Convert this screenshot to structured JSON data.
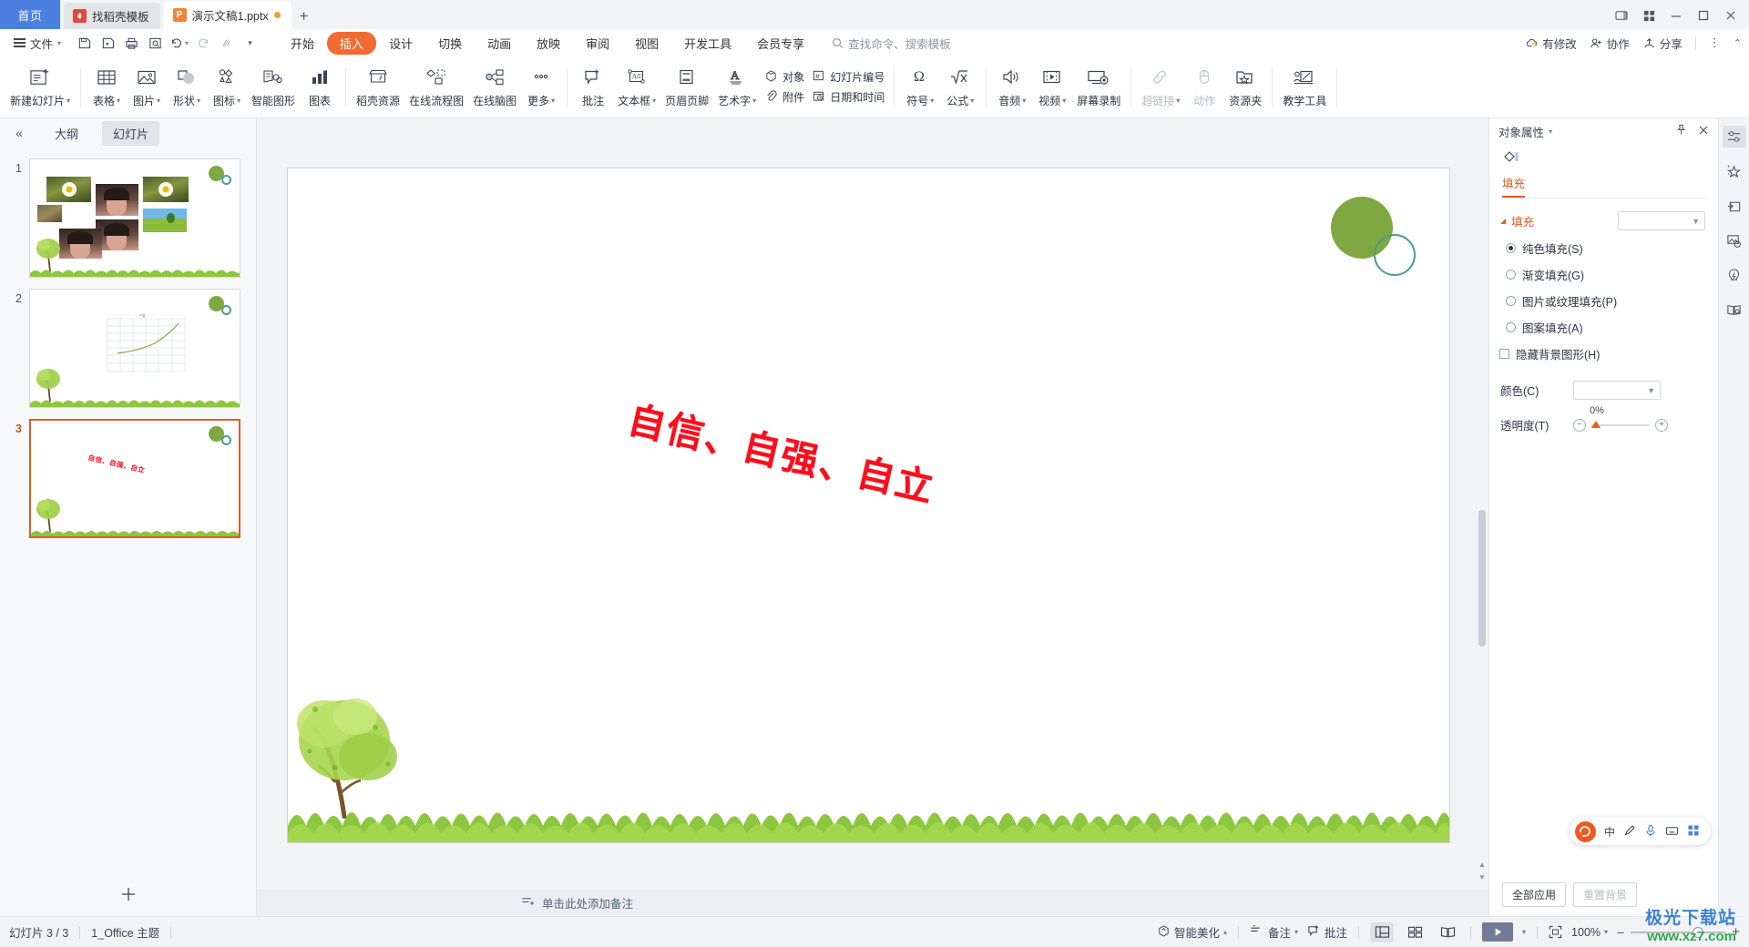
{
  "window": {
    "home_tab": "首页",
    "tabs": [
      {
        "label": "找稻壳模板",
        "icon": "daoke-icon",
        "active": false,
        "modified": false
      },
      {
        "label": "演示文稿1.pptx",
        "icon": "wpp-icon",
        "active": true,
        "modified": true
      }
    ],
    "new_tab": "+",
    "controls": [
      "restore-icon",
      "grid-icon",
      "minimize-icon",
      "maximize-icon",
      "close-icon"
    ]
  },
  "menu": {
    "file_label": "文件",
    "quick_access": [
      "save-icon",
      "save-as-icon",
      "print-icon",
      "print-preview-icon",
      "undo-icon",
      "redo-icon",
      "format-painter-icon",
      "customize-icon"
    ],
    "ribbon_tabs": [
      {
        "label": "开始",
        "selected": false
      },
      {
        "label": "插入",
        "selected": true
      },
      {
        "label": "设计",
        "selected": false
      },
      {
        "label": "切换",
        "selected": false
      },
      {
        "label": "动画",
        "selected": false
      },
      {
        "label": "放映",
        "selected": false
      },
      {
        "label": "审阅",
        "selected": false
      },
      {
        "label": "视图",
        "selected": false
      },
      {
        "label": "开发工具",
        "selected": false
      },
      {
        "label": "会员专享",
        "selected": false
      }
    ],
    "search_placeholder": "查找命令、搜索模板",
    "right_items": [
      {
        "label": "有修改",
        "icon": "cloud-sync-icon"
      },
      {
        "label": "协作",
        "icon": "collaborate-icon"
      },
      {
        "label": "分享",
        "icon": "share-icon"
      }
    ],
    "more_icon": "more-vertical-icon",
    "collapse_icon": "chevron-up-icon"
  },
  "ribbon": {
    "groups": [
      {
        "buttons": [
          {
            "label": "新建幻灯片",
            "icon": "new-slide-icon",
            "dropdown": true,
            "disabled": false
          }
        ]
      },
      {
        "buttons": [
          {
            "label": "表格",
            "icon": "table-icon",
            "dropdown": true,
            "disabled": false
          },
          {
            "label": "图片",
            "icon": "picture-icon",
            "dropdown": true,
            "disabled": false
          },
          {
            "label": "形状",
            "icon": "shapes-icon",
            "dropdown": true,
            "disabled": false
          },
          {
            "label": "图标",
            "icon": "icons-icon",
            "dropdown": true,
            "disabled": false
          },
          {
            "label": "智能图形",
            "icon": "smartart-icon",
            "dropdown": false,
            "disabled": false
          },
          {
            "label": "图表",
            "icon": "chart-icon",
            "dropdown": false,
            "disabled": false
          }
        ]
      },
      {
        "buttons": [
          {
            "label": "稻壳资源",
            "icon": "docer-resource-icon",
            "dropdown": false,
            "disabled": false
          },
          {
            "label": "在线流程图",
            "icon": "flowchart-icon",
            "dropdown": false,
            "disabled": false
          },
          {
            "label": "在线脑图",
            "icon": "mindmap-icon",
            "dropdown": false,
            "disabled": false
          },
          {
            "label": "更多",
            "icon": "more-dots-icon",
            "dropdown": true,
            "disabled": false
          }
        ]
      },
      {
        "buttons": [
          {
            "label": "批注",
            "icon": "comment-icon",
            "dropdown": false,
            "disabled": false
          },
          {
            "label": "文本框",
            "icon": "textbox-icon",
            "dropdown": true,
            "disabled": false
          },
          {
            "label": "页眉页脚",
            "icon": "header-footer-icon",
            "dropdown": false,
            "disabled": false
          },
          {
            "label": "艺术字",
            "icon": "wordart-icon",
            "dropdown": true,
            "disabled": false
          }
        ]
      },
      {
        "stacked": [
          {
            "label": "对象",
            "icon": "object-icon"
          },
          {
            "label": "附件",
            "icon": "attachment-icon"
          }
        ],
        "stacked2": [
          {
            "label": "幻灯片编号",
            "icon": "slide-number-icon"
          },
          {
            "label": "日期和时间",
            "icon": "date-time-icon"
          }
        ]
      },
      {
        "buttons": [
          {
            "label": "符号",
            "icon": "symbol-omega-icon",
            "dropdown": true,
            "disabled": false
          },
          {
            "label": "公式",
            "icon": "formula-icon",
            "dropdown": true,
            "disabled": false
          }
        ]
      },
      {
        "buttons": [
          {
            "label": "音频",
            "icon": "audio-icon",
            "dropdown": true,
            "disabled": false
          },
          {
            "label": "视频",
            "icon": "video-icon",
            "dropdown": true,
            "disabled": false
          },
          {
            "label": "屏幕录制",
            "icon": "screen-record-icon",
            "dropdown": false,
            "disabled": false
          }
        ]
      },
      {
        "buttons": [
          {
            "label": "超链接",
            "icon": "hyperlink-icon",
            "dropdown": true,
            "disabled": true
          },
          {
            "label": "动作",
            "icon": "action-mouse-icon",
            "dropdown": false,
            "disabled": true
          },
          {
            "label": "资源夹",
            "icon": "resource-folder-icon",
            "dropdown": false,
            "disabled": false
          }
        ]
      },
      {
        "buttons": [
          {
            "label": "教学工具",
            "icon": "teaching-tool-icon",
            "dropdown": false,
            "disabled": false
          }
        ]
      }
    ]
  },
  "slide_pane": {
    "collapse_icon": "double-chevron-left-icon",
    "view_tabs": [
      {
        "label": "大纲",
        "active": false
      },
      {
        "label": "幻灯片",
        "active": true
      }
    ],
    "slides": [
      {
        "number": "1",
        "active": false,
        "kind": "photos"
      },
      {
        "number": "2",
        "active": false,
        "kind": "chart"
      },
      {
        "number": "3",
        "active": true,
        "kind": "wordart"
      }
    ],
    "add_slide_icon": "plus-icon"
  },
  "canvas": {
    "wordart_text": "自信、自强、自立",
    "wordart_color": "#fc0d1c",
    "decor": {
      "circle_fill": "#7fa842",
      "ring_stroke": "#4d9e8a",
      "grass_color": "#8dc63f"
    }
  },
  "notes": {
    "placeholder": "单击此处添加备注",
    "icon": "add-note-icon"
  },
  "properties": {
    "title": "对象属性",
    "title_caret": "chevron-down-icon",
    "pin_icon": "pin-icon",
    "close_icon": "close-icon",
    "shape_icon": "shape-fill-icon",
    "tab": "填充",
    "section": "填充",
    "fill_options": [
      {
        "label": "纯色填充(S)",
        "selected": true
      },
      {
        "label": "渐变填充(G)",
        "selected": false
      },
      {
        "label": "图片或纹理填充(P)",
        "selected": false
      },
      {
        "label": "图案填充(A)",
        "selected": false
      }
    ],
    "hide_bg_label": "隐藏背景图形(H)",
    "hide_bg_checked": false,
    "color_label": "颜色(C)",
    "transparency_label": "透明度(T)",
    "transparency_value": "0%",
    "footer_buttons": [
      {
        "label": "全部应用",
        "disabled": false
      },
      {
        "label": "重置背景",
        "disabled": true
      }
    ]
  },
  "rail": {
    "items": [
      {
        "icon": "properties-sliders-icon",
        "active": true
      },
      {
        "icon": "beautify-star-icon",
        "active": false
      },
      {
        "icon": "insert-shape-icon",
        "active": false
      },
      {
        "icon": "image-palette-icon",
        "active": false
      },
      {
        "icon": "ai-bulb-icon",
        "active": false
      },
      {
        "icon": "book-search-icon",
        "active": false
      }
    ]
  },
  "status": {
    "slide_counter": "幻灯片 3 / 3",
    "theme": "1_Office 主题",
    "right_items": [
      {
        "label": "智能美化",
        "icon": "beautify-icon",
        "caret": true
      },
      {
        "label": "备注",
        "icon": "notes-icon",
        "caret": true
      },
      {
        "label": "批注",
        "icon": "comment-add-icon",
        "caret": false
      }
    ],
    "view_buttons": [
      {
        "icon": "normal-view-icon",
        "active": true
      },
      {
        "icon": "slide-sorter-icon",
        "active": false
      },
      {
        "icon": "reading-view-icon",
        "active": false
      }
    ],
    "play_icon": "play-icon",
    "play_caret": "chevron-down-icon",
    "fit_icon": "fit-slide-icon",
    "zoom_level": "100%",
    "zoom_minus": "−",
    "zoom_plus": "+"
  },
  "ime": {
    "logo": "S",
    "mode": "中",
    "icons": [
      "pen-icon",
      "mic-icon",
      "keyboard-icon",
      "apps-icon"
    ]
  },
  "watermark": {
    "line1": "极光下载站",
    "line2": "www.xz7.com"
  }
}
